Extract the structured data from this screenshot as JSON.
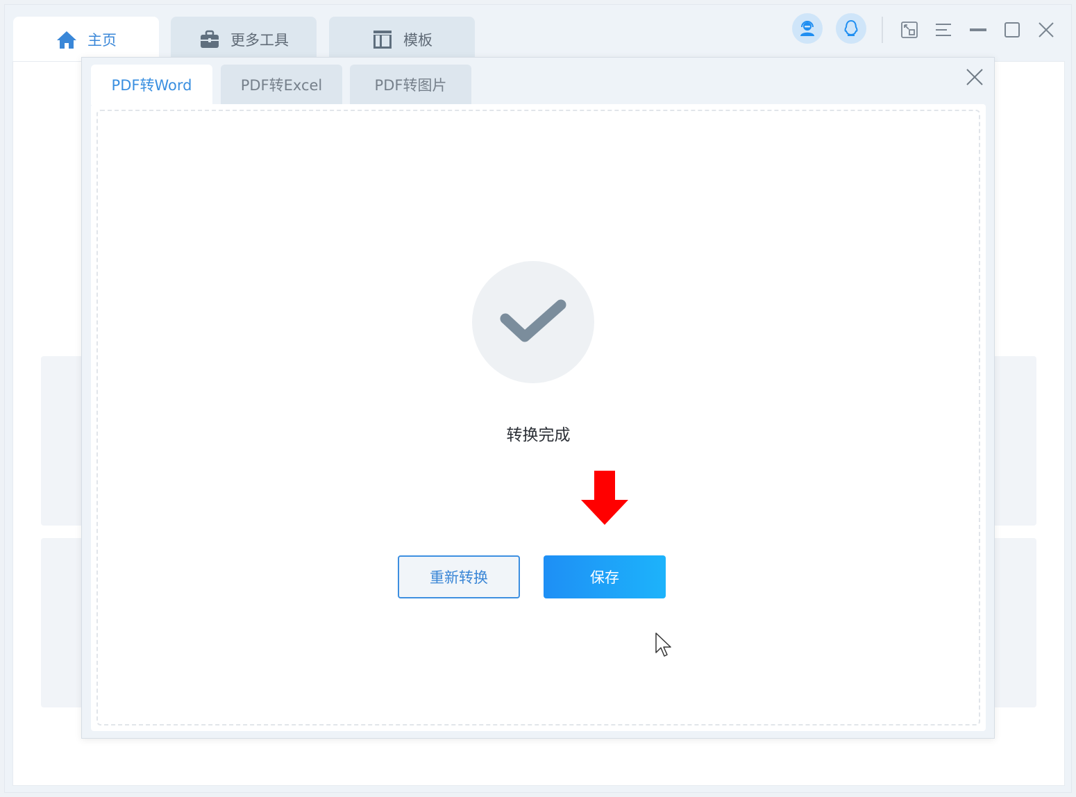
{
  "main_tabs": [
    {
      "label": "主页",
      "icon": "home-icon",
      "active": true
    },
    {
      "label": "更多工具",
      "icon": "toolbox-icon",
      "active": false
    },
    {
      "label": "模板",
      "icon": "template-icon",
      "active": false
    }
  ],
  "dialog": {
    "tabs": [
      {
        "label": "PDF转Word",
        "active": true
      },
      {
        "label": "PDF转Excel",
        "active": false
      },
      {
        "label": "PDF转图片",
        "active": false
      }
    ],
    "status": "转换完成",
    "reconvert_label": "重新转换",
    "save_label": "保存"
  },
  "colors": {
    "accent": "#3a8fe0",
    "save_gradient_start": "#1e8ff5",
    "save_gradient_end": "#1db3fb",
    "check": "#7b8d9c",
    "arrow": "#ff0000"
  }
}
